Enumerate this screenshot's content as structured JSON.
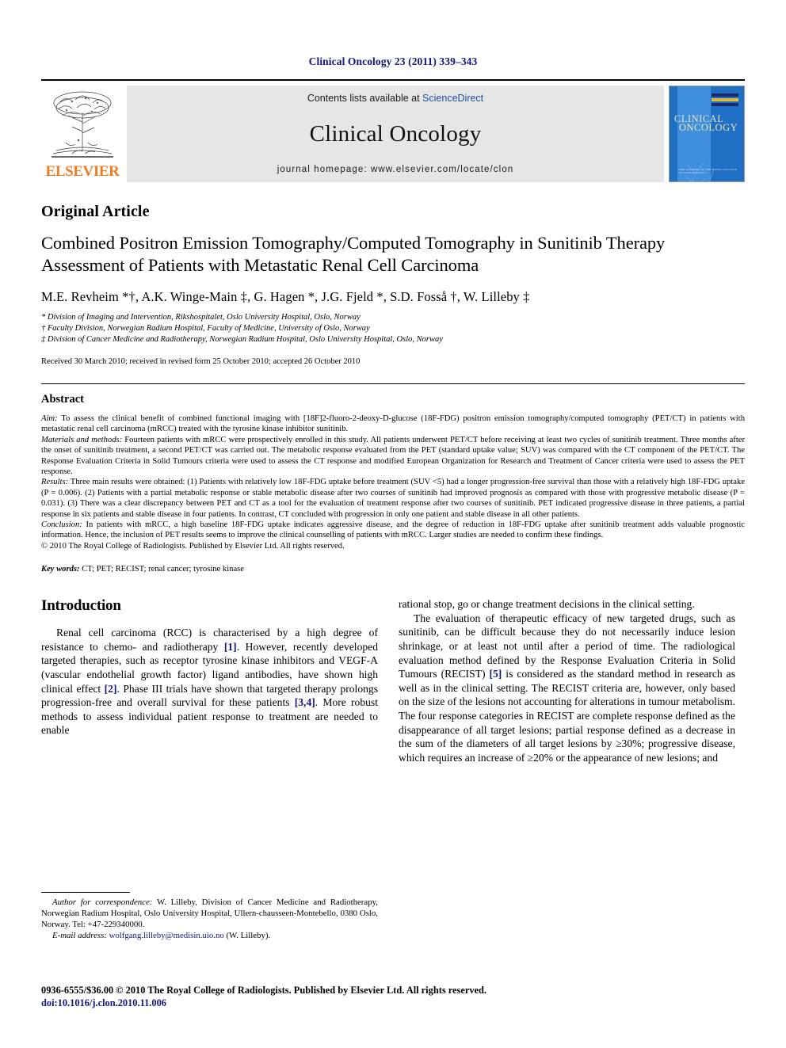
{
  "running_head": "Clinical Oncology 23 (2011) 339–343",
  "header": {
    "publisher_name": "ELSEVIER",
    "contents_prefix": "Contents lists available at ",
    "contents_link": "ScienceDirect",
    "journal_name": "Clinical Oncology",
    "homepage": "journal homepage: www.elsevier.com/locate/clon",
    "cover": {
      "line1": "CLINICAL",
      "line2": "ONCOLOGY",
      "footer": "THE JOURNAL OF THE ROYAL COLLEGE OF RADIOLOGISTS"
    }
  },
  "article": {
    "type": "Original Article",
    "title": "Combined Positron Emission Tomography/Computed Tomography in Sunitinib Therapy Assessment of Patients with Metastatic Renal Cell Carcinoma",
    "authors": "M.E. Revheim *†, A.K. Winge-Main ‡, G. Hagen *, J.G. Fjeld *, S.D. Fosså †, W. Lilleby ‡",
    "affiliations": [
      "* Division of Imaging and Intervention, Rikshospitalet, Oslo University Hospital, Oslo, Norway",
      "† Faculty Division, Norwegian Radium Hospital, Faculty of Medicine, University of Oslo, Norway",
      "‡ Division of Cancer Medicine and Radiotherapy, Norwegian Radium Hospital, Oslo University Hospital, Oslo, Norway"
    ],
    "history": "Received 30 March 2010; received in revised form 25 October 2010; accepted 26 October 2010"
  },
  "abstract": {
    "heading": "Abstract",
    "aim_label": "Aim:",
    "aim_text": " To assess the clinical benefit of combined functional imaging with [18F]2-fluoro-2-deoxy-D-glucose (18F-FDG) positron emission tomography/computed tomography (PET/CT) in patients with metastatic renal cell carcinoma (mRCC) treated with the tyrosine kinase inhibitor sunitinib.",
    "methods_label": "Materials and methods:",
    "methods_text": " Fourteen patients with mRCC were prospectively enrolled in this study. All patients underwent PET/CT before receiving at least two cycles of sunitinib treatment. Three months after the onset of sunitinib treatment, a second PET/CT was carried out. The metabolic response evaluated from the PET (standard uptake value; SUV) was compared with the CT component of the PET/CT. The Response Evaluation Criteria in Solid Tumours criteria were used to assess the CT response and modified European Organization for Research and Treatment of Cancer criteria were used to assess the PET response.",
    "results_label": "Results:",
    "results_text": " Three main results were obtained: (1) Patients with relatively low 18F-FDG uptake before treatment (SUV <5) had a longer progression-free survival than those with a relatively high 18F-FDG uptake (P = 0.006). (2) Patients with a partial metabolic response or stable metabolic disease after two courses of sunitinib had improved prognosis as compared with those with progressive metabolic disease (P = 0.031). (3) There was a clear discrepancy between PET and CT as a tool for the evaluation of treatment response after two courses of sunitinib. PET indicated progressive disease in three patients, a partial response in six patients and stable disease in four patients. In contrast, CT concluded with progression in only one patient and stable disease in all other patients.",
    "conclusion_label": "Conclusion:",
    "conclusion_text": " In patients with mRCC, a high baseline 18F-FDG uptake indicates aggressive disease, and the degree of reduction in 18F-FDG uptake after sunitinib treatment adds valuable prognostic information. Hence, the inclusion of PET results seems to improve the clinical counselling of patients with mRCC. Larger studies are needed to confirm these findings.",
    "copyright": "© 2010 The Royal College of Radiologists. Published by Elsevier Ltd. All rights reserved.",
    "keywords_label": "Key words:",
    "keywords_text": " CT; PET; RECIST; renal cancer; tyrosine kinase"
  },
  "introduction": {
    "heading": "Introduction",
    "left_p1_a": "Renal cell carcinoma (RCC) is characterised by a high degree of resistance to chemo- and radiotherapy ",
    "left_ref1": "[1]",
    "left_p1_b": ". However, recently developed targeted therapies, such as receptor tyrosine kinase inhibitors and VEGF-A (vascular endothelial growth factor) ligand antibodies, have shown high clinical effect ",
    "left_ref2": "[2]",
    "left_p1_c": ". Phase III trials have shown that targeted therapy prolongs progression-free and overall survival for these patients ",
    "left_ref3": "[3,4]",
    "left_p1_d": ". More robust methods to assess individual patient response to treatment are needed to enable",
    "right_p1": "rational stop, go or change treatment decisions in the clinical setting.",
    "right_p2_a": "The evaluation of therapeutic efficacy of new targeted drugs, such as sunitinib, can be difficult because they do not necessarily induce lesion shrinkage, or at least not until after a period of time. The radiological evaluation method defined by the Response Evaluation Criteria in Solid Tumours (RECIST) ",
    "right_ref5": "[5]",
    "right_p2_b": " is considered as the standard method in research as well as in the clinical setting. The RECIST criteria are, however, only based on the size of the lesions not accounting for alterations in tumour metabolism. The four response categories in RECIST are complete response defined as the disappearance of all target lesions; partial response defined as a decrease in the sum of the diameters of all target lesions by ≥30%; progressive disease, which requires an increase of ≥20% or the appearance of new lesions; and"
  },
  "footnote": {
    "correspondence_label": "Author for correspondence:",
    "correspondence_text": " W. Lilleby, Division of Cancer Medicine and Radiotherapy, Norwegian Radium Hospital, Oslo University Hospital, Ullern-chausseen-Montebello, 0380 Oslo, Norway. Tel: +47-229340000.",
    "email_label": "E-mail address:",
    "email_value": " wolfgang.lilleby@medisin.uio.no",
    "email_suffix": " (W. Lilleby)."
  },
  "imprint": {
    "line1": "0936-6555/$36.00 © 2010 The Royal College of Radiologists. Published by Elsevier Ltd. All rights reserved.",
    "doi_label": "doi:",
    "doi_value": "10.1016/j.clon.2010.11.006"
  }
}
